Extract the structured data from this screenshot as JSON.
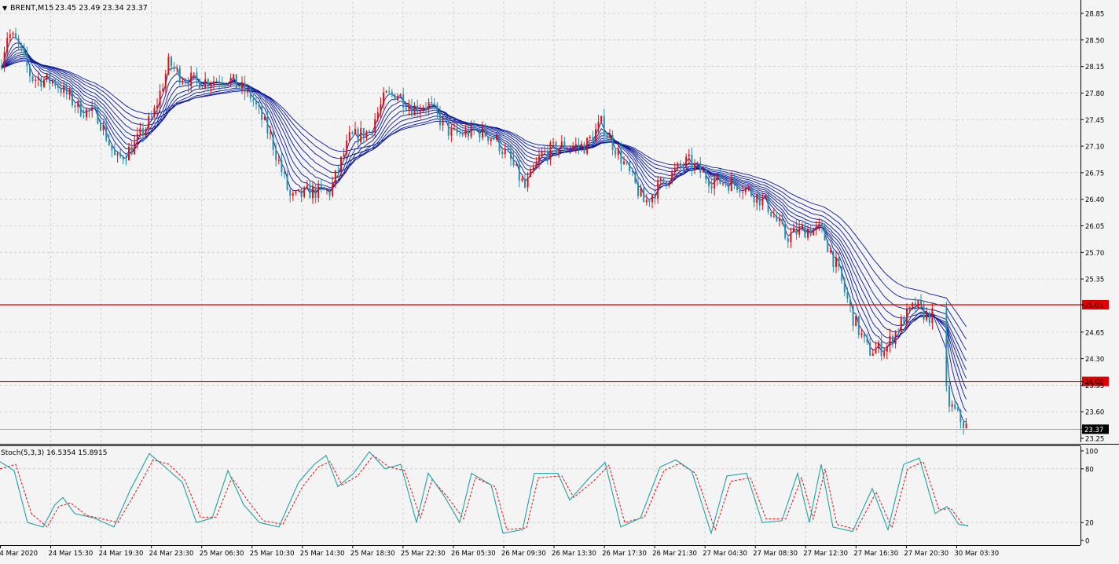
{
  "header": {
    "symbol": "BRENT,M15",
    "ohlc": "23.45 23.49 23.34 23.37"
  },
  "colors": {
    "background": "#f4f4f4",
    "grid": "#c8c8c8",
    "bull_candle": "#e01010",
    "bear_candle": "#2a8fa8",
    "ma_ribbon": "#0a1a9a",
    "level_line": "#e00000",
    "stoch_main": "#1fa3a3",
    "stoch_signal": "#e01010"
  },
  "chart_data": [
    {
      "type": "candlestick",
      "title": "BRENT,M15",
      "ylim": [
        23.25,
        28.85
      ],
      "yticks": [
        "28.85",
        "28.50",
        "28.15",
        "27.80",
        "27.45",
        "27.10",
        "26.75",
        "26.40",
        "26.05",
        "25.70",
        "25.35",
        "25.01",
        "24.65",
        "24.30",
        "24.00",
        "23.95",
        "23.60",
        "23.37",
        "23.25"
      ],
      "xticks": [
        "4 Mar 2020",
        "24 Mar 15:30",
        "24 Mar 19:30",
        "24 Mar 23:30",
        "25 Mar 06:30",
        "25 Mar 10:30",
        "25 Mar 14:30",
        "25 Mar 18:30",
        "25 Mar 22:30",
        "26 Mar 05:30",
        "26 Mar 09:30",
        "26 Mar 13:30",
        "26 Mar 17:30",
        "26 Mar 21:30",
        "27 Mar 04:30",
        "27 Mar 08:30",
        "27 Mar 12:30",
        "27 Mar 16:30",
        "27 Mar 20:30",
        "30 Mar 03:30"
      ],
      "price_path": [
        [
          0,
          28.15
        ],
        [
          10,
          28.6
        ],
        [
          22,
          28.45
        ],
        [
          40,
          28.0
        ],
        [
          70,
          27.95
        ],
        [
          100,
          27.6
        ],
        [
          125,
          27.5
        ],
        [
          148,
          26.9
        ],
        [
          170,
          27.1
        ],
        [
          195,
          27.5
        ],
        [
          215,
          28.2
        ],
        [
          232,
          28.0
        ],
        [
          255,
          27.95
        ],
        [
          290,
          28.0
        ],
        [
          320,
          27.75
        ],
        [
          345,
          27.2
        ],
        [
          370,
          26.4
        ],
        [
          395,
          26.5
        ],
        [
          420,
          26.5
        ],
        [
          445,
          27.2
        ],
        [
          470,
          27.3
        ],
        [
          490,
          27.75
        ],
        [
          505,
          27.8
        ],
        [
          525,
          27.6
        ],
        [
          545,
          27.65
        ],
        [
          575,
          27.25
        ],
        [
          610,
          27.3
        ],
        [
          630,
          27.2
        ],
        [
          650,
          26.9
        ],
        [
          668,
          26.55
        ],
        [
          690,
          27.0
        ],
        [
          715,
          27.1
        ],
        [
          745,
          27.1
        ],
        [
          765,
          27.4
        ],
        [
          790,
          26.95
        ],
        [
          820,
          26.35
        ],
        [
          845,
          26.65
        ],
        [
          875,
          26.9
        ],
        [
          905,
          26.65
        ],
        [
          940,
          26.6
        ],
        [
          975,
          26.35
        ],
        [
          1000,
          25.9
        ],
        [
          1020,
          26.0
        ],
        [
          1045,
          26.0
        ],
        [
          1065,
          25.5
        ],
        [
          1085,
          24.85
        ],
        [
          1105,
          24.4
        ],
        [
          1128,
          24.45
        ],
        [
          1145,
          24.75
        ],
        [
          1165,
          25.0
        ],
        [
          1180,
          24.85
        ],
        [
          1198,
          24.9
        ],
        [
          1205,
          23.75
        ],
        [
          1218,
          23.55
        ],
        [
          1232,
          23.37
        ]
      ],
      "ma_ribbon_periods": [
        3,
        6,
        9,
        12,
        16,
        20,
        25,
        32,
        40,
        50
      ],
      "levels": [
        {
          "value": "25.01"
        },
        {
          "value": "24.00"
        }
      ],
      "current_price": "23.37"
    },
    {
      "type": "line",
      "title": "Stoch(5,3,3) 16.5354 15.8915",
      "ylim": [
        0,
        100
      ],
      "yticks": [
        "100",
        "80",
        "20",
        "0"
      ],
      "series": [
        {
          "values": [
            [
              0,
              88
            ],
            [
              18,
              78
            ],
            [
              35,
              20
            ],
            [
              55,
              15
            ],
            [
              70,
              40
            ],
            [
              80,
              48
            ],
            [
              95,
              30
            ],
            [
              120,
              25
            ],
            [
              145,
              15
            ],
            [
              165,
              55
            ],
            [
              190,
              97
            ],
            [
              210,
              82
            ],
            [
              232,
              65
            ],
            [
              250,
              20
            ],
            [
              270,
              25
            ],
            [
              290,
              78
            ],
            [
              310,
              40
            ],
            [
              330,
              20
            ],
            [
              355,
              15
            ],
            [
              380,
              65
            ],
            [
              400,
              85
            ],
            [
              415,
              95
            ],
            [
              430,
              60
            ],
            [
              450,
              75
            ],
            [
              470,
              99
            ],
            [
              490,
              80
            ],
            [
              510,
              85
            ],
            [
              530,
              20
            ],
            [
              545,
              75
            ],
            [
              565,
              50
            ],
            [
              585,
              20
            ],
            [
              600,
              75
            ],
            [
              625,
              62
            ],
            [
              640,
              8
            ],
            [
              665,
              12
            ],
            [
              680,
              75
            ],
            [
              710,
              75
            ],
            [
              725,
              45
            ],
            [
              750,
              70
            ],
            [
              770,
              87
            ],
            [
              790,
              15
            ],
            [
              815,
              25
            ],
            [
              840,
              82
            ],
            [
              860,
              90
            ],
            [
              880,
              78
            ],
            [
              905,
              8
            ],
            [
              925,
              72
            ],
            [
              950,
              75
            ],
            [
              970,
              20
            ],
            [
              995,
              22
            ],
            [
              1015,
              75
            ],
            [
              1030,
              20
            ],
            [
              1045,
              85
            ],
            [
              1060,
              15
            ],
            [
              1085,
              10
            ],
            [
              1110,
              58
            ],
            [
              1130,
              12
            ],
            [
              1150,
              85
            ],
            [
              1170,
              92
            ],
            [
              1190,
              30
            ],
            [
              1205,
              38
            ],
            [
              1220,
              18
            ],
            [
              1232,
              16.5
            ]
          ]
        },
        {
          "values": [
            [
              0,
              80
            ],
            [
              20,
              85
            ],
            [
              40,
              30
            ],
            [
              60,
              15
            ],
            [
              75,
              38
            ],
            [
              90,
              42
            ],
            [
              110,
              28
            ],
            [
              130,
              24
            ],
            [
              150,
              20
            ],
            [
              170,
              50
            ],
            [
              195,
              90
            ],
            [
              215,
              85
            ],
            [
              235,
              68
            ],
            [
              255,
              26
            ],
            [
              275,
              26
            ],
            [
              295,
              70
            ],
            [
              315,
              45
            ],
            [
              335,
              22
            ],
            [
              360,
              18
            ],
            [
              385,
              60
            ],
            [
              405,
              82
            ],
            [
              420,
              88
            ],
            [
              435,
              62
            ],
            [
              455,
              72
            ],
            [
              475,
              95
            ],
            [
              495,
              82
            ],
            [
              515,
              78
            ],
            [
              535,
              25
            ],
            [
              550,
              68
            ],
            [
              570,
              48
            ],
            [
              590,
              24
            ],
            [
              605,
              70
            ],
            [
              630,
              60
            ],
            [
              645,
              12
            ],
            [
              670,
              14
            ],
            [
              685,
              70
            ],
            [
              715,
              72
            ],
            [
              730,
              48
            ],
            [
              755,
              66
            ],
            [
              775,
              84
            ],
            [
              795,
              20
            ],
            [
              820,
              26
            ],
            [
              845,
              78
            ],
            [
              865,
              86
            ],
            [
              885,
              75
            ],
            [
              910,
              12
            ],
            [
              930,
              66
            ],
            [
              955,
              70
            ],
            [
              975,
              24
            ],
            [
              1000,
              24
            ],
            [
              1020,
              70
            ],
            [
              1035,
              24
            ],
            [
              1050,
              80
            ],
            [
              1065,
              18
            ],
            [
              1090,
              12
            ],
            [
              1115,
              54
            ],
            [
              1135,
              14
            ],
            [
              1155,
              80
            ],
            [
              1175,
              88
            ],
            [
              1195,
              34
            ],
            [
              1210,
              36
            ],
            [
              1225,
              18
            ],
            [
              1232,
              15.9
            ]
          ]
        }
      ]
    }
  ]
}
